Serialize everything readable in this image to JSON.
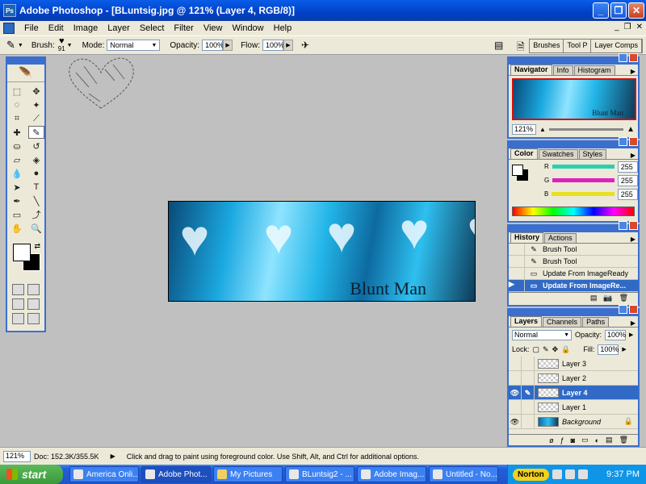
{
  "window": {
    "title": "Adobe Photoshop - [BLuntsig.jpg @ 121% (Layer 4, RGB/8)]",
    "buttons": {
      "minimize": "_",
      "restore": "❐",
      "close": "✕"
    }
  },
  "menu": [
    "File",
    "Edit",
    "Image",
    "Layer",
    "Select",
    "Filter",
    "View",
    "Window",
    "Help"
  ],
  "options": {
    "brush_label": "Brush:",
    "brush_size": "91",
    "mode_label": "Mode:",
    "mode_value": "Normal",
    "opacity_label": "Opacity:",
    "opacity_value": "100%",
    "flow_label": "Flow:",
    "flow_value": "100%",
    "palette_well": [
      "Brushes",
      "Tool P",
      "Layer Comps"
    ]
  },
  "navigator": {
    "tabs": [
      "Navigator",
      "Info",
      "Histogram"
    ],
    "zoom": "121%",
    "thumb_text": "Blunt Man"
  },
  "color": {
    "tabs": [
      "Color",
      "Swatches",
      "Styles"
    ],
    "channels": [
      {
        "label": "R",
        "value": "255",
        "color": "#2ad0b0"
      },
      {
        "label": "G",
        "value": "255",
        "color": "#e020c0"
      },
      {
        "label": "B",
        "value": "255",
        "color": "#e8e020"
      }
    ]
  },
  "history": {
    "tabs": [
      "History",
      "Actions"
    ],
    "items": [
      "Brush Tool",
      "Brush Tool",
      "Update From ImageReady",
      "Update From ImageRe..."
    ],
    "selected_index": 3
  },
  "layers": {
    "tabs": [
      "Layers",
      "Channels",
      "Paths"
    ],
    "blend_mode": "Normal",
    "opacity_label": "Opacity:",
    "opacity_value": "100%",
    "lock_label": "Lock:",
    "fill_label": "Fill:",
    "fill_value": "100%",
    "items": [
      "Layer 3",
      "Layer 2",
      "Layer 4",
      "Layer 1",
      "Background"
    ],
    "selected_index": 2
  },
  "canvas": {
    "signature": "Blunt Man"
  },
  "statusbar": {
    "zoom": "121%",
    "doc": "Doc: 152.3K/355.5K",
    "hint": "Click and drag to paint using foreground color.  Use Shift, Alt, and Ctrl for additional options."
  },
  "taskbar": {
    "start": "start",
    "tasks": [
      "America Onli...",
      "Adobe Phot...",
      "My Pictures",
      "BLuntsig2 - ...",
      "Adobe Imag...",
      "Untitled - No..."
    ],
    "active_index": 1,
    "norton": "Norton",
    "clock": "9:37 PM"
  }
}
